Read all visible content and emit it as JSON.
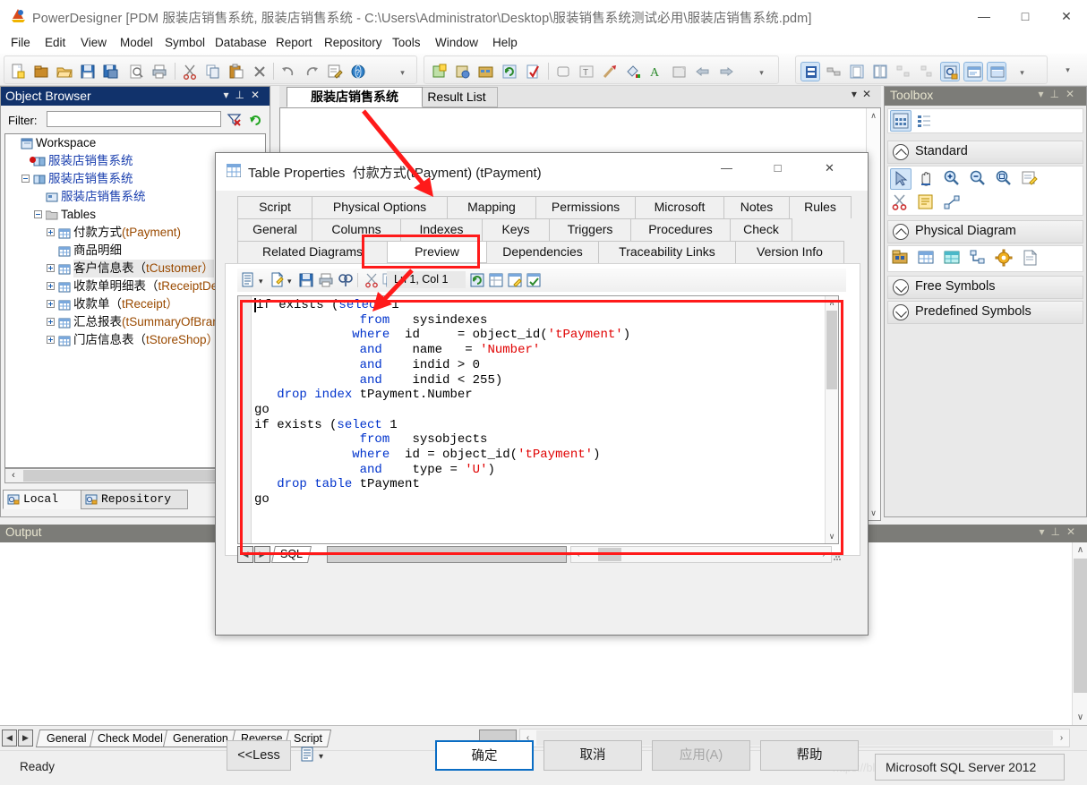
{
  "window": {
    "title": "PowerDesigner [PDM 服装店销售系统, 服装店销售系统 - C:\\Users\\Administrator\\Desktop\\服装销售系统测试必用\\服装店销售系统.pdm]",
    "minimize": "—",
    "maximize": "□",
    "close": "✕"
  },
  "menubar": {
    "items": [
      "File",
      "Edit",
      "View",
      "Model",
      "Symbol",
      "Database",
      "Report",
      "Repository",
      "Tools",
      "Window",
      "Help"
    ]
  },
  "object_browser": {
    "title": "Object Browser",
    "filter_label": "Filter:",
    "filter_value": "",
    "filter_placeholder": "",
    "tree": [
      {
        "label_cn": "Workspace",
        "label_en": "",
        "indent": 0,
        "expander": "none",
        "icon": "workspace-icon"
      },
      {
        "label_cn": "服装店销售系统",
        "label_en": "",
        "indent": 1,
        "expander": "none",
        "icon": "model-red-icon"
      },
      {
        "label_cn": "服装店销售系统",
        "label_en": "",
        "indent": 1,
        "expander": "minus",
        "icon": "model-icon"
      },
      {
        "label_cn": "服装店销售系统",
        "label_en": "",
        "indent": 2,
        "expander": "none",
        "icon": "diagram-icon"
      },
      {
        "label_cn": "Tables",
        "label_en": "",
        "indent": 2,
        "expander": "minus",
        "icon": "folder-icon"
      },
      {
        "label_cn": "付款方式",
        "label_en": "(tPayment)",
        "indent": 3,
        "expander": "plus",
        "icon": "table-icon"
      },
      {
        "label_cn": "商品明细",
        "label_en": "",
        "indent": 3,
        "expander": "none",
        "icon": "table-icon"
      },
      {
        "label_cn": "客户信息表（",
        "label_en": "tCustomer）",
        "indent": 3,
        "expander": "plus",
        "icon": "table-icon",
        "selected": true
      },
      {
        "label_cn": "收款单明细表（",
        "label_en": "tReceiptDetail）",
        "indent": 3,
        "expander": "plus",
        "icon": "table-icon"
      },
      {
        "label_cn": "收款单（",
        "label_en": "tReceipt）",
        "indent": 3,
        "expander": "plus",
        "icon": "table-icon"
      },
      {
        "label_cn": "汇总报表",
        "label_en": "(tSummaryOfBranch)",
        "indent": 3,
        "expander": "plus",
        "icon": "table-icon"
      },
      {
        "label_cn": "门店信息表（",
        "label_en": "tStoreShop）",
        "indent": 3,
        "expander": "plus",
        "icon": "table-icon"
      }
    ],
    "tabs": [
      {
        "label": "Local",
        "active": true,
        "icon": "local-icon"
      },
      {
        "label": "Repository",
        "active": false,
        "icon": "repository-icon"
      }
    ]
  },
  "document_tabs": [
    {
      "label": "服装店销售系统",
      "active": true
    },
    {
      "label": "Result List",
      "active": false
    }
  ],
  "toolbox": {
    "title": "Toolbox",
    "sections": [
      {
        "label": "Standard",
        "collapsed": false,
        "tools": [
          "pointer-icon",
          "hand-icon",
          "zoom-in-icon",
          "zoom-out-icon",
          "zoom-area-icon",
          "properties-icon",
          "scissors-icon",
          "note-icon",
          "link-icon"
        ]
      },
      {
        "label": "Physical Diagram",
        "collapsed": false,
        "tools": [
          "package-icon",
          "table-icon",
          "view-icon",
          "reference-icon",
          "procedure-icon",
          "file-icon"
        ]
      },
      {
        "label": "Free Symbols",
        "collapsed": true,
        "tools": []
      },
      {
        "label": "Predefined Symbols",
        "collapsed": true,
        "tools": []
      }
    ],
    "top_modes": [
      "grid-view-icon",
      "list-view-icon"
    ]
  },
  "output_panel": {
    "title": "Output",
    "content": ""
  },
  "bottom_tabs": [
    {
      "label": "General"
    },
    {
      "label": "Check Model"
    },
    {
      "label": "Generation"
    },
    {
      "label": "Reverse"
    },
    {
      "label": "Script"
    }
  ],
  "status_bar": {
    "ready": "Ready",
    "watermark": "https://blog.csdn.net/",
    "database": "Microsoft SQL Server 2012"
  },
  "dialog": {
    "title": "Table Properties",
    "subtitle": "付款方式(tPayment) (tPayment)",
    "minimize": "—",
    "maximize": "□",
    "close": "✕",
    "tab_rows": [
      [
        "Script",
        "Physical Options",
        "Mapping",
        "Permissions",
        "Microsoft",
        "Notes",
        "Rules"
      ],
      [
        "General",
        "Columns",
        "Indexes",
        "Keys",
        "Triggers",
        "Procedures",
        "Check"
      ],
      [
        "Related Diagrams",
        "Preview",
        "Dependencies",
        "Traceability Links",
        "Version Info"
      ]
    ],
    "active_tab": "Preview",
    "editor_toolbar": {
      "icons": [
        "editor-menu-icon",
        "new-doc-icon",
        "save-icon",
        "print-icon",
        "find-icon",
        "cut-icon",
        "copy-icon",
        "paste-icon",
        "undo-icon",
        "redo-icon",
        "refresh-icon",
        "properties-grid-icon",
        "edit-script-icon",
        "check-script-icon"
      ],
      "position": "Ln 1, Col 1"
    },
    "sql_tab": "SQL",
    "code_lines": [
      [
        {
          "t": "if exists (",
          "c": "kw-if"
        },
        {
          "t": "select",
          "c": "kw"
        },
        {
          "t": " 1",
          "c": "plain"
        }
      ],
      [
        {
          "t": "              ",
          "c": "plain"
        },
        {
          "t": "from",
          "c": "kw"
        },
        {
          "t": "   sysindexes",
          "c": "plain"
        }
      ],
      [
        {
          "t": "             ",
          "c": "plain"
        },
        {
          "t": "where",
          "c": "kw"
        },
        {
          "t": "  id     = object_id(",
          "c": "plain"
        },
        {
          "t": "'tPayment'",
          "c": "str"
        },
        {
          "t": ")",
          "c": "plain"
        }
      ],
      [
        {
          "t": "              ",
          "c": "plain"
        },
        {
          "t": "and",
          "c": "kw"
        },
        {
          "t": "    name   = ",
          "c": "plain"
        },
        {
          "t": "'Number'",
          "c": "str"
        }
      ],
      [
        {
          "t": "              ",
          "c": "plain"
        },
        {
          "t": "and",
          "c": "kw"
        },
        {
          "t": "    indid > 0",
          "c": "plain"
        }
      ],
      [
        {
          "t": "              ",
          "c": "plain"
        },
        {
          "t": "and",
          "c": "kw"
        },
        {
          "t": "    indid < 255)",
          "c": "plain"
        }
      ],
      [
        {
          "t": "   ",
          "c": "plain"
        },
        {
          "t": "drop",
          "c": "kw"
        },
        {
          "t": " ",
          "c": "plain"
        },
        {
          "t": "index",
          "c": "kw"
        },
        {
          "t": " tPayment.Number",
          "c": "plain"
        }
      ],
      [
        {
          "t": "go",
          "c": "plain"
        }
      ],
      [
        {
          "t": "",
          "c": "plain"
        }
      ],
      [
        {
          "t": "if exists (",
          "c": "kw-if"
        },
        {
          "t": "select",
          "c": "kw"
        },
        {
          "t": " 1",
          "c": "plain"
        }
      ],
      [
        {
          "t": "              ",
          "c": "plain"
        },
        {
          "t": "from",
          "c": "kw"
        },
        {
          "t": "   sysobjects",
          "c": "plain"
        }
      ],
      [
        {
          "t": "             ",
          "c": "plain"
        },
        {
          "t": "where",
          "c": "kw"
        },
        {
          "t": "  id = object_id(",
          "c": "plain"
        },
        {
          "t": "'tPayment'",
          "c": "str"
        },
        {
          "t": ")",
          "c": "plain"
        }
      ],
      [
        {
          "t": "              ",
          "c": "plain"
        },
        {
          "t": "and",
          "c": "kw"
        },
        {
          "t": "    type = ",
          "c": "plain"
        },
        {
          "t": "'U'",
          "c": "str"
        },
        {
          "t": ")",
          "c": "plain"
        }
      ],
      [
        {
          "t": "   ",
          "c": "plain"
        },
        {
          "t": "drop",
          "c": "kw"
        },
        {
          "t": " ",
          "c": "plain"
        },
        {
          "t": "table",
          "c": "kw"
        },
        {
          "t": " tPayment",
          "c": "plain"
        }
      ],
      [
        {
          "t": "go",
          "c": "plain"
        }
      ]
    ],
    "buttons": [
      {
        "label": "<<Less",
        "kind": "normal",
        "name": "less-button"
      },
      {
        "label": "确定",
        "kind": "primary",
        "name": "ok-button"
      },
      {
        "label": "取消",
        "kind": "normal",
        "name": "cancel-button"
      },
      {
        "label": "应用(A)",
        "kind": "disabled",
        "name": "apply-button"
      },
      {
        "label": "帮助",
        "kind": "normal",
        "name": "help-button"
      }
    ]
  },
  "colors": {
    "title_blue": "#11326b",
    "panel_gray": "#7c7c78",
    "accent_red": "#ff1a1a",
    "keyword_blue": "#0033cc",
    "string_red": "#e00000",
    "primary_border": "#0a6dc4"
  }
}
